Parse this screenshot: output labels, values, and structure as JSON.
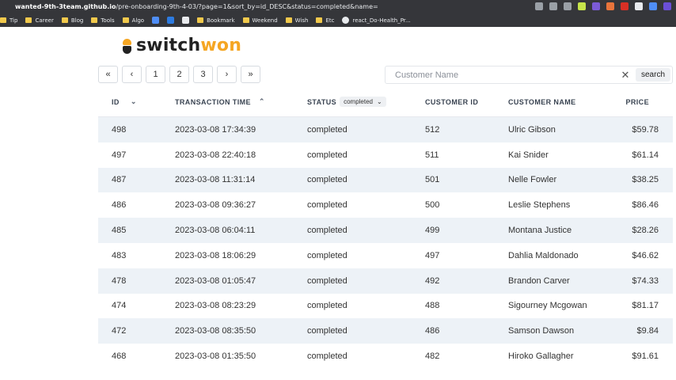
{
  "browser": {
    "url_host": "wanted-9th-3team.github.io",
    "url_path": "/pre-onboarding-9th-4-03/?page=1&sort_by=id_DESC&status=completed&name=",
    "bookmarks": [
      "Tip",
      "Career",
      "Blog",
      "Tools",
      "Algo",
      "Bookmark",
      "Weekend",
      "Wish",
      "Etc",
      "react_Do-Health_Pr..."
    ]
  },
  "logo": {
    "part1": "switch",
    "part2": "won"
  },
  "pagination": {
    "first": "«",
    "prev": "‹",
    "pages": [
      "1",
      "2",
      "3"
    ],
    "next": "›",
    "last": "»"
  },
  "search": {
    "placeholder": "Customer Name",
    "value": "",
    "clear": "✕",
    "button": "search"
  },
  "table": {
    "headers": {
      "id": "ID",
      "time": "TRANSACTION TIME",
      "status": "STATUS",
      "status_filter": "completed",
      "customer_id": "CUSTOMER ID",
      "customer_name": "CUSTOMER NAME",
      "price": "PRICE"
    },
    "rows": [
      [
        "498",
        "2023-03-08 17:34:39",
        "completed",
        "512",
        "Ulric Gibson",
        "$59.78"
      ],
      [
        "497",
        "2023-03-08 22:40:18",
        "completed",
        "511",
        "Kai Snider",
        "$61.14"
      ],
      [
        "487",
        "2023-03-08 11:31:14",
        "completed",
        "501",
        "Nelle Fowler",
        "$38.25"
      ],
      [
        "486",
        "2023-03-08 09:36:27",
        "completed",
        "500",
        "Leslie Stephens",
        "$86.46"
      ],
      [
        "485",
        "2023-03-08 06:04:11",
        "completed",
        "499",
        "Montana Justice",
        "$28.26"
      ],
      [
        "483",
        "2023-03-08 18:06:29",
        "completed",
        "497",
        "Dahlia Maldonado",
        "$46.62"
      ],
      [
        "478",
        "2023-03-08 01:05:47",
        "completed",
        "492",
        "Brandon Carver",
        "$74.33"
      ],
      [
        "474",
        "2023-03-08 08:23:29",
        "completed",
        "488",
        "Sigourney Mcgowan",
        "$81.17"
      ],
      [
        "472",
        "2023-03-08 08:35:50",
        "completed",
        "486",
        "Samson Dawson",
        "$9.84"
      ],
      [
        "468",
        "2023-03-08 01:35:50",
        "completed",
        "482",
        "Hiroko Gallagher",
        "$91.61"
      ]
    ]
  }
}
